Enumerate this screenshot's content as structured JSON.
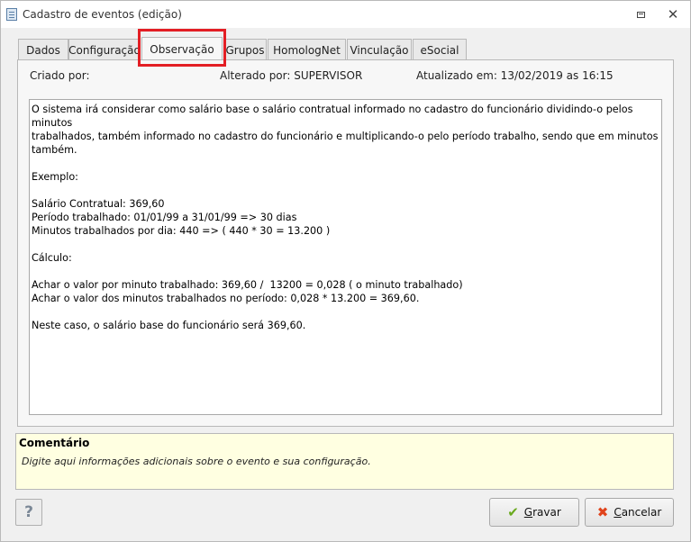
{
  "window": {
    "title": "Cadastro de eventos (edição)",
    "restore_icon": "restore-icon",
    "close_icon": "close-icon",
    "close_glyph": "✕"
  },
  "tabs": [
    {
      "label": "Dados"
    },
    {
      "label": "Configuração"
    },
    {
      "label": "Observação"
    },
    {
      "label": "Grupos"
    },
    {
      "label": "HomologNet"
    },
    {
      "label": "Vinculação"
    },
    {
      "label": "eSocial"
    }
  ],
  "active_tab": "Observação",
  "highlight_color": "#e31e24",
  "meta": {
    "created": "Criado por:",
    "altered": "Alterado por: SUPERVISOR",
    "updated": "Atualizado em: 13/02/2019 as 16:15"
  },
  "observation_lines": [
    "O sistema irá considerar como salário base o salário contratual informado no cadastro do funcionário dividindo-o pelos minutos",
    "trabalhados, também informado no cadastro do funcionário e multiplicando-o pelo período trabalho, sendo que em minutos",
    "também.",
    "",
    "Exemplo:",
    "",
    "Salário Contratual: 369,60",
    "Período trabalhado: 01/01/99 a 31/01/99 => 30 dias",
    "Minutos trabalhados por dia: 440 => ( 440 * 30 = 13.200 )",
    "",
    "Cálculo:",
    "",
    "Achar o valor por minuto trabalhado: 369,60 /  13200 = 0,028 ( o minuto trabalhado)",
    "Achar o valor dos minutos trabalhados no período: 0,028 * 13.200 = 369,60.",
    "",
    "Neste caso, o salário base do funcionário será 369,60."
  ],
  "comment": {
    "title": "Comentário",
    "text": "Digite aqui informações adicionais sobre o evento e sua configuração."
  },
  "buttons": {
    "help": "?",
    "save": "Gravar",
    "cancel": "Cancelar",
    "save_icon": "check-icon",
    "cancel_icon": "cancel-x-icon",
    "save_glyph": "✔",
    "cancel_glyph": "✖"
  }
}
